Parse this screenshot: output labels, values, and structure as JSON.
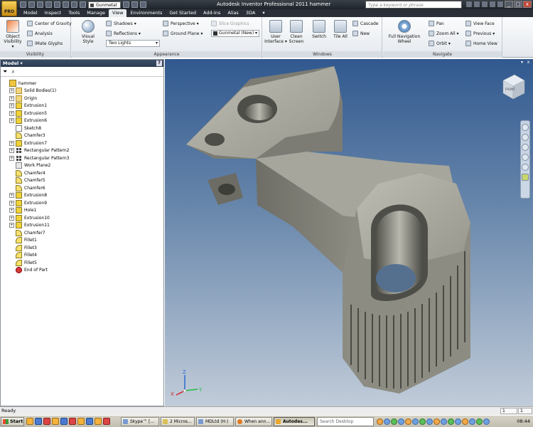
{
  "window": {
    "title": "Autodesk Inventor Professional 2011    hammer",
    "app_button_label": "PRO",
    "quick_access_material": "Gunmetal (N",
    "search_placeholder": "Type a keyword or phrase"
  },
  "menu_tabs": [
    "Model",
    "Inspect",
    "Tools",
    "Manage",
    "View",
    "Environments",
    "Get Started",
    "Add-Ins",
    "Alias",
    "3DA",
    "▾"
  ],
  "active_tab": "View",
  "ribbon": {
    "visibility": {
      "label": "Visibility",
      "object_visibility": "Object\nVisibility ▾",
      "center_of_gravity": "Center of Gravity",
      "analysis": "Analysis",
      "mate_glyphs": "iMate Glyphs"
    },
    "appearance": {
      "label": "Appearance",
      "visual_style": "Visual Style",
      "shadows": "Shadows ▾",
      "reflections": "Reflections ▾",
      "lighting": "Two Lights",
      "perspective": "Perspective ▾",
      "ground_plane": "Ground Plane ▾",
      "slice_graphics": "Slice Graphics",
      "material": "Gunmetal (New)"
    },
    "windows": {
      "label": "Windows",
      "user_interface": "User\nInterface ▾",
      "clean_screen": "Clean\nScreen",
      "switch": "Switch",
      "tile_all": "Tile All",
      "cascade": "Cascade",
      "new": "New"
    },
    "navigate": {
      "label": "Navigate",
      "full_nav_wheel": "Full Navigation\nWheel",
      "pan": "Pan",
      "zoom_all": "Zoom All ▾",
      "orbit": "Orbit ▾",
      "view_face": "View Face",
      "previous": "Previous ▾",
      "home_view": "Home View"
    }
  },
  "browser": {
    "title": "Model ▾",
    "help": "?",
    "tree": [
      {
        "label": "hammer",
        "type": "part",
        "expander": "",
        "indent": 0
      },
      {
        "label": "Solid Bodies(1)",
        "type": "folder",
        "expander": "+",
        "indent": 1
      },
      {
        "label": "Origin",
        "type": "folder",
        "expander": "+",
        "indent": 1
      },
      {
        "label": "Extrusion1",
        "type": "feature",
        "expander": "+",
        "indent": 1
      },
      {
        "label": "Extrusion5",
        "type": "feature",
        "expander": "+",
        "indent": 1
      },
      {
        "label": "Extrusion6",
        "type": "feature",
        "expander": "+",
        "indent": 1
      },
      {
        "label": "Sketch8",
        "type": "sketch",
        "expander": "",
        "indent": 1
      },
      {
        "label": "Chamfer3",
        "type": "chamfer",
        "expander": "",
        "indent": 1
      },
      {
        "label": "Extrusion7",
        "type": "feature",
        "expander": "+",
        "indent": 1
      },
      {
        "label": "Rectangular Pattern2",
        "type": "pattern",
        "expander": "+",
        "indent": 1
      },
      {
        "label": "Rectangular Pattern3",
        "type": "pattern",
        "expander": "+",
        "indent": 1
      },
      {
        "label": "Work Plane2",
        "type": "plane",
        "expander": "",
        "indent": 1
      },
      {
        "label": "Chamfer4",
        "type": "chamfer",
        "expander": "",
        "indent": 1
      },
      {
        "label": "Chamfer5",
        "type": "chamfer",
        "expander": "",
        "indent": 1
      },
      {
        "label": "Chamfer6",
        "type": "chamfer",
        "expander": "",
        "indent": 1
      },
      {
        "label": "Extrusion8",
        "type": "feature",
        "expander": "+",
        "indent": 1
      },
      {
        "label": "Extrusion9",
        "type": "feature",
        "expander": "+",
        "indent": 1
      },
      {
        "label": "Hole1",
        "type": "feature",
        "expander": "+",
        "indent": 1
      },
      {
        "label": "Extrusion10",
        "type": "feature",
        "expander": "+",
        "indent": 1
      },
      {
        "label": "Extrusion11",
        "type": "feature",
        "expander": "+",
        "indent": 1
      },
      {
        "label": "Chamfer7",
        "type": "chamfer",
        "expander": "",
        "indent": 1
      },
      {
        "label": "Fillet1",
        "type": "fillet",
        "expander": "",
        "indent": 1
      },
      {
        "label": "Fillet3",
        "type": "fillet",
        "expander": "",
        "indent": 1
      },
      {
        "label": "Fillet4",
        "type": "fillet",
        "expander": "",
        "indent": 1
      },
      {
        "label": "Fillet5",
        "type": "fillet",
        "expander": "",
        "indent": 1
      },
      {
        "label": "End of Part",
        "type": "end",
        "expander": "",
        "indent": 1
      }
    ]
  },
  "viewport": {
    "viewcube_label": "FRONT",
    "triad": {
      "x": "X",
      "y": "Y",
      "z": "Z"
    },
    "colors": {
      "top": "#31598f",
      "bottom": "#c1ccd9",
      "part": "#8a8a80"
    }
  },
  "status": {
    "text": "Ready",
    "num1": "1",
    "num2": "1"
  },
  "taskbar": {
    "start": "Start",
    "tasks": [
      {
        "label": "Skype™ [...",
        "kind": "sk"
      },
      {
        "label": "2 Micros...",
        "kind": "ex"
      },
      {
        "label": "MDLtd (H:)",
        "kind": "fo"
      },
      {
        "label": "When ann...",
        "kind": "ff"
      },
      {
        "label": "Autodes...",
        "kind": "inv"
      }
    ],
    "search": "Search Desktop",
    "clock": "08:44"
  }
}
